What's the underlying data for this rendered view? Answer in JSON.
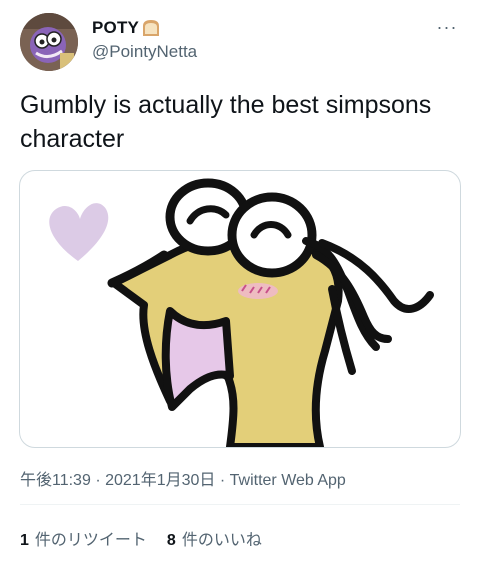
{
  "author": {
    "display_name": "POTY",
    "name_emoji": "bread-emoji-icon",
    "handle": "@PointyNetta"
  },
  "tweet": {
    "text": "Gumbly is actually the best simpsons character"
  },
  "meta": {
    "time": "午後11:39",
    "separator1": "·",
    "date": "2021年1月30日",
    "separator2": "·",
    "source": "Twitter Web App"
  },
  "stats": {
    "retweets_count": "1",
    "retweets_label": "件のリツイート",
    "likes_count": "8",
    "likes_label": "件のいいね"
  },
  "colors": {
    "text": "#0f1419",
    "secondary": "#536471",
    "border": "#cfd9de",
    "drawing_yellow": "#e6d27a",
    "drawing_mouth": "#e6c8e8",
    "drawing_heart": "#dccbe6"
  }
}
